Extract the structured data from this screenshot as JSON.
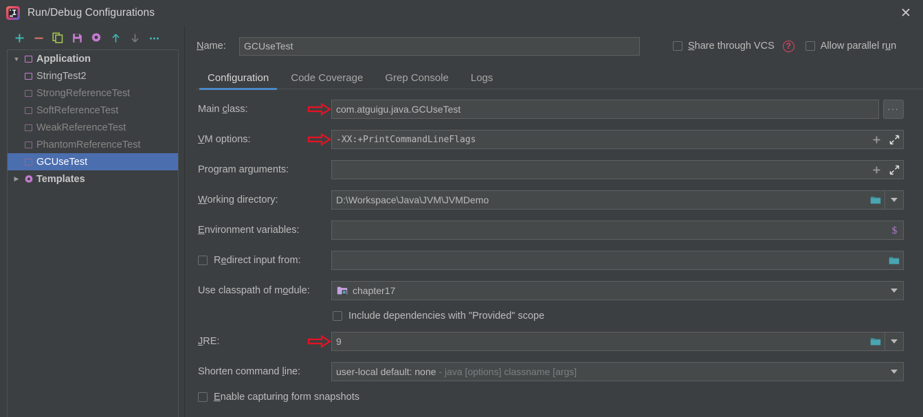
{
  "window": {
    "title": "Run/Debug Configurations",
    "app_icon": "intellij-idea-logo",
    "close_label": "✕"
  },
  "toolbar": {
    "buttons": [
      {
        "name": "add-configuration",
        "icon": "plus-icon",
        "color": "#3fb8b8"
      },
      {
        "name": "remove-configuration",
        "icon": "minus-icon",
        "color": "#e0756a"
      },
      {
        "name": "copy-configuration",
        "icon": "copy-icon",
        "color": "#a8c954"
      },
      {
        "name": "save-configuration",
        "icon": "save-icon",
        "color": "#c77dd4"
      },
      {
        "name": "edit-templates",
        "icon": "gear-icon",
        "color": "#c77dd4"
      },
      {
        "name": "move-up",
        "icon": "arrow-up-icon",
        "color": "#3fb8b8"
      },
      {
        "name": "move-down",
        "icon": "arrow-down-icon",
        "color": "#7a7a7a"
      },
      {
        "name": "more-options",
        "icon": "ellipsis-icon",
        "color": "#3fb8b8"
      }
    ]
  },
  "tree": {
    "items": [
      {
        "label": "Application",
        "level": 0,
        "expanded": true,
        "bold": true,
        "icon": "application-square-icon",
        "selected": false,
        "dim": false
      },
      {
        "label": "StringTest2",
        "level": 1,
        "expanded": null,
        "bold": false,
        "icon": "configuration-square-icon",
        "selected": false,
        "dim": false
      },
      {
        "label": "StrongReferenceTest",
        "level": 1,
        "expanded": null,
        "bold": false,
        "icon": "configuration-square-icon",
        "selected": false,
        "dim": true
      },
      {
        "label": "SoftReferenceTest",
        "level": 1,
        "expanded": null,
        "bold": false,
        "icon": "configuration-square-icon",
        "selected": false,
        "dim": true
      },
      {
        "label": "WeakReferenceTest",
        "level": 1,
        "expanded": null,
        "bold": false,
        "icon": "configuration-square-icon",
        "selected": false,
        "dim": true
      },
      {
        "label": "PhantomReferenceTest",
        "level": 1,
        "expanded": null,
        "bold": false,
        "icon": "configuration-square-icon",
        "selected": false,
        "dim": true
      },
      {
        "label": "GCUseTest",
        "level": 1,
        "expanded": null,
        "bold": false,
        "icon": "configuration-square-icon",
        "selected": true,
        "dim": false
      },
      {
        "label": "Templates",
        "level": 0,
        "expanded": false,
        "bold": true,
        "icon": "templates-gear-icon",
        "selected": false,
        "dim": false
      }
    ]
  },
  "header": {
    "name_label": "Name:",
    "name_value": "GCUseTest",
    "share_vcs_label": "Share through VCS",
    "share_vcs_checked": false,
    "help_icon": "help-circle-icon",
    "allow_parallel_label": "Allow parallel run",
    "allow_parallel_checked": false
  },
  "tabs": [
    {
      "label": "Configuration",
      "active": true
    },
    {
      "label": "Code Coverage",
      "active": false
    },
    {
      "label": "Grep Console",
      "active": false
    },
    {
      "label": "Logs",
      "active": false
    }
  ],
  "form": {
    "main_class": {
      "label": "Main class:",
      "value": "com.atguigu.java.GCUseTest",
      "browse_label": "...",
      "marked": true
    },
    "vm_options": {
      "label": "VM options:",
      "value": "-XX:+PrintCommandLineFlags",
      "marked": true,
      "macro_icon": "plus-icon",
      "expand_icon": "expand-diagonal-icon"
    },
    "program_arguments": {
      "label": "Program arguments:",
      "value": "",
      "marked": false,
      "macro_icon": "plus-icon",
      "expand_icon": "expand-diagonal-icon"
    },
    "working_directory": {
      "label": "Working directory:",
      "value": "D:\\Workspace\\Java\\JVM\\JVMDemo",
      "browse_icon": "folder-icon",
      "dropdown_icon": "chevron-down-icon"
    },
    "environment_variables": {
      "label": "Environment variables:",
      "value": "",
      "macro_icon": "dollar-icon"
    },
    "redirect_input": {
      "label": "Redirect input from:",
      "checked": false,
      "value": "",
      "browse_icon": "folder-icon"
    },
    "use_classpath": {
      "label": "Use classpath of module:",
      "value": "chapter17",
      "module_icon": "module-folder-icon",
      "dropdown_icon": "chevron-down-icon"
    },
    "include_provided": {
      "label": "Include dependencies with \"Provided\" scope",
      "checked": false
    },
    "jre": {
      "label": "JRE:",
      "value": "9",
      "marked": true,
      "browse_icon": "folder-icon",
      "dropdown_icon": "chevron-down-icon"
    },
    "shorten_command_line": {
      "label": "Shorten command line:",
      "value": "user-local default: none",
      "value_hint": " - java [options] classname [args]",
      "dropdown_icon": "chevron-down-icon"
    },
    "enable_capturing": {
      "label": "Enable capturing form snapshots",
      "checked": false
    }
  },
  "colors": {
    "background": "#3c3f41",
    "field_background": "#45494a",
    "selection": "#4b6eaf",
    "accent_tab": "#4a88c7",
    "annotation_arrow": "#e81123",
    "help_red": "#db4665",
    "purple": "#c77dd4",
    "teal": "#3fb8b8"
  }
}
